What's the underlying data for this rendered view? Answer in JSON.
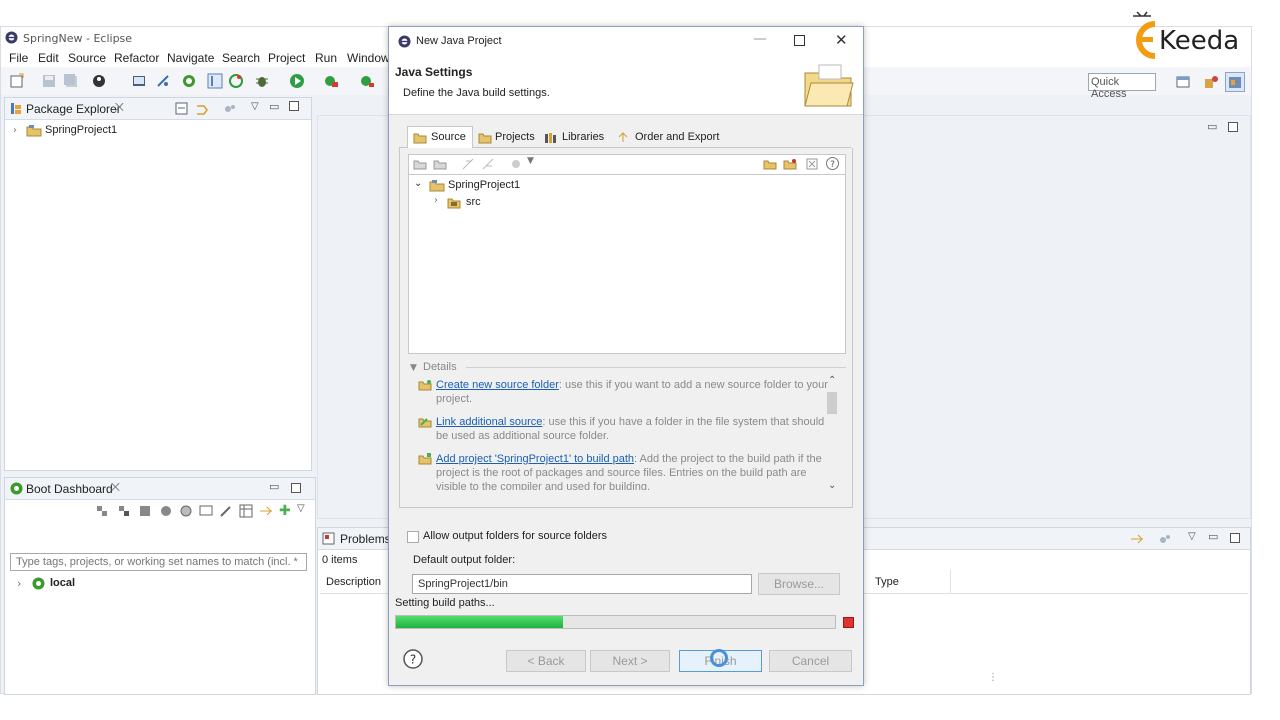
{
  "window": {
    "title": "SpringNew - Eclipse"
  },
  "menu": [
    "File",
    "Edit",
    "Source",
    "Refactor",
    "Navigate",
    "Search",
    "Project",
    "Run",
    "Window"
  ],
  "quick_access": "Quick Access",
  "brand": {
    "logo_text": "Keeda",
    "logo_prefix": "E"
  },
  "package_explorer": {
    "title": "Package Explorer",
    "items": [
      "SpringProject1"
    ]
  },
  "boot_dashboard": {
    "title": "Boot Dashboard",
    "filter_placeholder": "Type tags, projects, or working set names to match (incl. * ar",
    "items": [
      "local"
    ]
  },
  "problems": {
    "title": "Problems",
    "count": "0 items",
    "col_description": "Description",
    "col_type": "Type"
  },
  "dialog": {
    "title": "New Java Project",
    "header_title": "Java Settings",
    "header_desc": "Define the Java build settings.",
    "tabs": [
      "Source",
      "Projects",
      "Libraries",
      "Order and Export"
    ],
    "tree": {
      "project": "SpringProject1",
      "child": "src"
    },
    "details_label": "Details",
    "details": [
      {
        "link": "Create new source folder",
        "text": ": use this if you want to add a new source folder to your project."
      },
      {
        "link": "Link additional source",
        "text": ": use this if you have a folder in the file system that should be used as additional source folder."
      },
      {
        "link": "Add project 'SpringProject1' to build path",
        "text": ": Add the project to the build path if the project is the root of packages and source files. Entries on the build path are visible to the compiler and used for building."
      }
    ],
    "allow_output_label": "Allow output folders for source folders",
    "output_folder_label": "Default output folder:",
    "output_folder_value": "SpringProject1/bin",
    "browse_label": "Browse...",
    "status_text": "Setting build paths...",
    "progress": 0.38,
    "buttons": {
      "back": "< Back",
      "next": "Next >",
      "finish": "Finish",
      "cancel": "Cancel"
    }
  },
  "colors": {
    "accent_link": "#1a5fb4",
    "progress_green": "#2ecc40",
    "logo_orange": "#f39c12"
  }
}
